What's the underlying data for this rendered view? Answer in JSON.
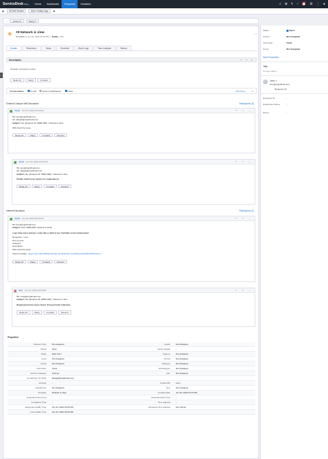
{
  "topbar": {
    "logo": "ServiceDesk",
    "logo_plus": "Plus",
    "nav": [
      "Home",
      "Dashboard",
      "Requests",
      "Solutions"
    ],
    "active_nav": "Requests"
  },
  "subbar": {
    "all_self_service": "All Self Service",
    "zoho_creator": "Zoho Creator App"
  },
  "toolbar": {
    "actions": "Actions ▾",
    "reply": "Reply ▾"
  },
  "request": {
    "id_title": "#8 Network is slow",
    "by_label": "By",
    "requester": "Leon",
    "created_on": "on Jun 20, 2023 01:03 PM",
    "due_by_label": "DueBy :",
    "due_by": "N/A"
  },
  "tabs": [
    "Details",
    "Resolution",
    "Tasks",
    "Checklist",
    "Work Logs",
    "Time Analysis",
    "History"
  ],
  "description": {
    "title": "Description",
    "text": "Network connection is slow"
  },
  "desc_buttons": [
    "Reply All",
    "Reply",
    "Forward"
  ],
  "conversations": {
    "label": "Conversations",
    "options": [
      "E-mail",
      "System Notifications",
      "Notes"
    ],
    "add_notes": "Add Notes"
  },
  "external_discussion": {
    "title": "External Campus Wifi Discussion",
    "participants": "Participants (3)"
  },
  "mail1": {
    "from": "Vivek",
    "time": "Jun 23, 2023 02:53 PM",
    "to_label": "To:",
    "to": "leon@zylpdfmail.com",
    "cc_label": "cc:",
    "cc": "abagel@zylpdfmail.com",
    "subject_label": "Subject:",
    "subject": "Re: [Request ID :##RE-8##] : Network is slow",
    "body": "Will check the issue.",
    "buttons": [
      "Reply All",
      "Reply",
      "Forward",
      "Resend"
    ]
  },
  "mail2": {
    "from": "Vivek",
    "time": "Jun 23, 2023 02:53 PM",
    "to": "leon@zylpdfmail.com",
    "cc": "abagel@zylpdfmail.com",
    "subject": "Re: [Request ID :##RE-8##] : Network is slow",
    "body": "Kindly submit your device for replacement.",
    "buttons": [
      "Reply All",
      "Reply",
      "Forward",
      "Resend"
    ]
  },
  "internal_discussion": {
    "title": "Internal Discussion",
    "participants": "Participants (2)"
  },
  "mail3": {
    "from": "Vivek",
    "time": "Jun 23, 2023 02:53 PM",
    "to": "leon@zylpdfmail.com",
    "subject": "Fwd: ##RE-8##: Network is slow]",
    "body": "Logs have been shared. Looks like a valid issue. Facilitate asset replacement.",
    "details": [
      "Requester : Leon",
      "Due by time",
      "Category",
      "Description :",
      "Will check the issue."
    ],
    "click_label": "Click for details :",
    "link": "https://vive.5467788/WorkOrder.do?woMode=viewWO&woID=8&PORTALID=1",
    "buttons": [
      "Reply All",
      "Reply",
      "Forward",
      "Resend"
    ]
  },
  "mail4": {
    "from": "Hari",
    "time": "Jun 23, 2023 02:53 PM",
    "to": "vivek@zylpdfmail.com",
    "subject": "Re: [Request ID :##RE-8##] : Network is slow",
    "body": "Replacement has been raised. Proceed with collection.",
    "buttons": [
      "Reply All",
      "Reply",
      "Forward",
      "Resend"
    ]
  },
  "properties": {
    "title": "Properties",
    "rows": [
      [
        "Request Type",
        "Not Assigned",
        "Impact",
        "Not Assigned"
      ],
      [
        "Status",
        "Open",
        "Impact Details",
        "-"
      ],
      [
        "Mode",
        "Web Form",
        "Urgency",
        "Not Assigned"
      ],
      [
        "Level",
        "Not Assigned",
        "Priority",
        "Not Assigned"
      ],
      [
        "Group",
        "Not Assigned",
        "Category",
        "Not Assigned"
      ],
      [
        "Technician",
        "Vivek",
        "Subcategory",
        "Not Assigned"
      ],
      [
        "Service Category",
        "Unsmet",
        "Item",
        "Not Assigned"
      ],
      [
        "E-mail Id(s) To Notify",
        "abagel@zylpdfmail.com",
        "",
        ""
      ],
      [
        "Asset(s)",
        "-",
        "Created By",
        "Leon"
      ],
      [
        "Department",
        "Not Assigned",
        "SLA",
        "Not Assigned"
      ],
      [
        "Template",
        "Network is slow",
        "Created Date",
        "Jun 20, 2023 01:03 PM"
      ],
      [
        "Scheduled Start Time",
        "-",
        "Scheduled End Time",
        "-"
      ],
      [
        "Completed Time",
        "-",
        "Time elapsed",
        "-"
      ],
      [
        "Response DueBy Time",
        "Jun 23, 2023 02:53 PM",
        "Response time elapsed",
        "1hrs 30min"
      ],
      [
        "Last Update Time",
        "Jun 23, 2023 02:53 PM",
        "",
        ""
      ]
    ]
  },
  "sidebar": {
    "status_label": "Status",
    "status": "Open",
    "priority_label": "Priority",
    "priority": "Not Assigned",
    "technician_label": "Technician",
    "technician": "Vivek",
    "group_label": "Group",
    "group": "Not Assigned",
    "more_properties": "More Properties",
    "tags_label": "Tags",
    "no_tags": "No tags added",
    "requester_name": "Leon",
    "requester_email": "leon@zylpdfmail.com",
    "requests_label": "Requests (1)",
    "employee_id_label": "Employee ID",
    "employee_id": "-",
    "department_label": "Department Name",
    "department": "-",
    "phone_label": "Phone",
    "phone": "-"
  }
}
